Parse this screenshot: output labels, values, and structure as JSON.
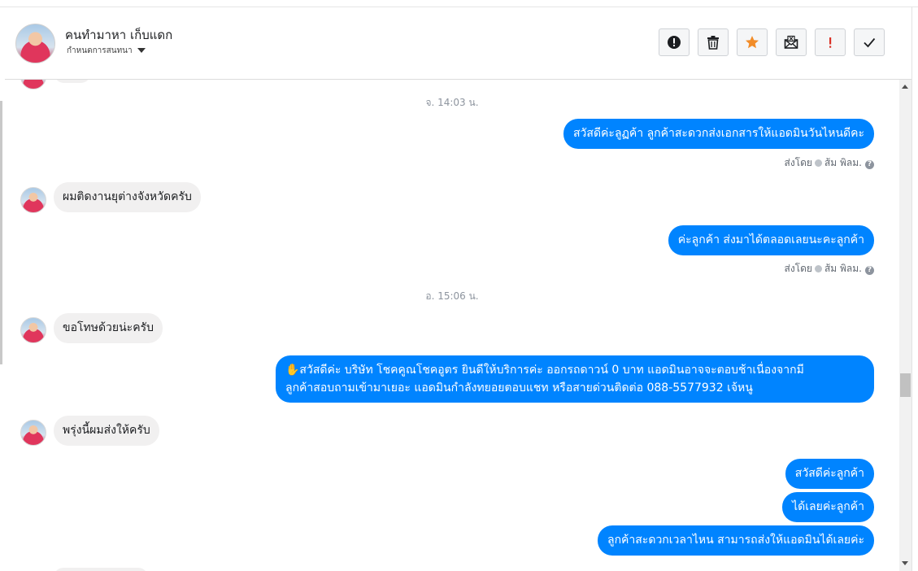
{
  "header": {
    "name": "คนทำมาหา เก็บแดก",
    "subtitle": "กำหนดการสนทนา",
    "toolbar": [
      {
        "icon": "exclamation-circle-icon"
      },
      {
        "icon": "trash-icon"
      },
      {
        "icon": "star-icon",
        "color": "#f28c28"
      },
      {
        "icon": "mail-x-icon"
      },
      {
        "icon": "exclamation-icon",
        "color": "#d93025"
      },
      {
        "icon": "check-icon"
      }
    ]
  },
  "messages": {
    "ts1": "จ. 14:03 น.",
    "out1": "สวัสดีค่ะลูฏค้า ลูกค้าสะดวกส่งเอกสารให้แอดมินวันไหนดีคะ",
    "sent1_prefix": "ส่งโดย",
    "sent1_name": "ส้ม พิลม.",
    "in1": "ผมติดงานยุต่างจังหวัดครับ",
    "out2": "ค่ะลูกค้า ส่งมาได้ตลอดเลยนะคะลูกค้า",
    "sent2_prefix": "ส่งโดย",
    "sent2_name": "ส้ม พิลม.",
    "ts2": "อ. 15:06 น.",
    "in2": "ขอโทษด้วยน่ะครับ",
    "out3_line1": "✋สวัสดีค่ะ บริษัท โชคคูณโชคอูตร ยินดีให้บริการค่ะ ออกรถดาวน์ 0 บาท แอดมินอาจจะตอบช้าเนื่องจากมี",
    "out3_line2": "ลูกค้าสอบถามเข้ามาเยอะ แอดมินกำลังทยอยตอบแชท หรือสายด่วนติดต่อ 088-5577932 เจ้หนู",
    "in3": "พรุ่งนี้ผมส่งให้ครับ",
    "out4": "สวัสดีค่ะลูกค้า",
    "out5": "ได้เลยค่ะลูกค้า",
    "out6": "ลูกค้าสะดวกเวลาไหน สามารถส่งให้แอดมินได้เลยค่ะ"
  },
  "colors": {
    "outgoing_bubble": "#0084ff",
    "incoming_bubble": "#f1f0f0"
  }
}
